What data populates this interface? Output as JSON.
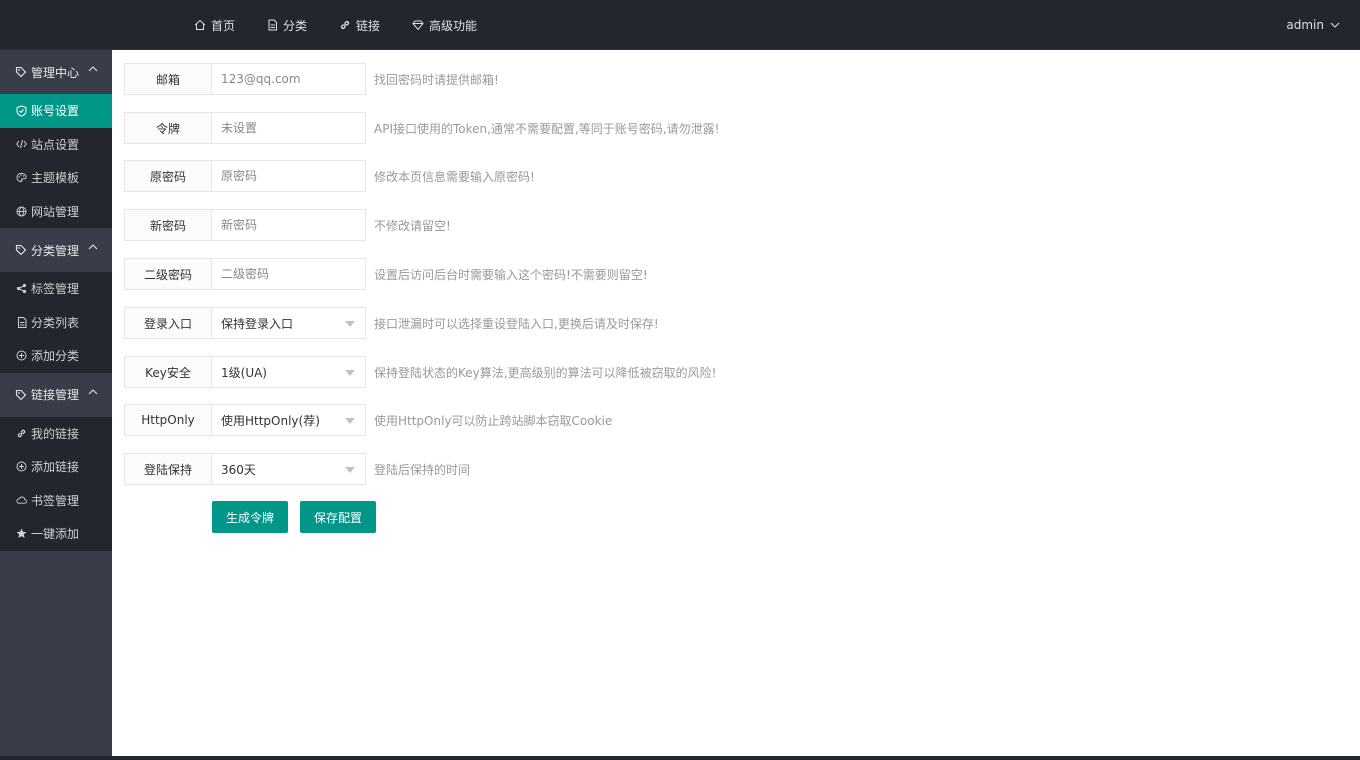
{
  "topnav": {
    "items": [
      {
        "label": "首页",
        "icon": "home-icon"
      },
      {
        "label": "分类",
        "icon": "file-icon"
      },
      {
        "label": "链接",
        "icon": "link-icon"
      },
      {
        "label": "高级功能",
        "icon": "diamond-icon"
      }
    ],
    "user": "admin"
  },
  "sidebar": {
    "groups": [
      {
        "title": "管理中心",
        "items": [
          {
            "label": "账号设置",
            "icon": "shield-icon",
            "active": true
          },
          {
            "label": "站点设置",
            "icon": "code-icon"
          },
          {
            "label": "主题模板",
            "icon": "palette-icon"
          },
          {
            "label": "网站管理",
            "icon": "globe-icon"
          }
        ]
      },
      {
        "title": "分类管理",
        "items": [
          {
            "label": "标签管理",
            "icon": "share-icon"
          },
          {
            "label": "分类列表",
            "icon": "file-icon"
          },
          {
            "label": "添加分类",
            "icon": "add-circle-icon"
          }
        ]
      },
      {
        "title": "链接管理",
        "items": [
          {
            "label": "我的链接",
            "icon": "link-icon"
          },
          {
            "label": "添加链接",
            "icon": "add-circle-icon"
          },
          {
            "label": "书签管理",
            "icon": "cloud-icon"
          },
          {
            "label": "一键添加",
            "icon": "star-icon"
          }
        ]
      }
    ]
  },
  "form": {
    "email": {
      "label": "邮箱",
      "value": "",
      "placeholder": "123@qq.com",
      "hint": "找回密码时请提供邮箱!"
    },
    "token": {
      "label": "令牌",
      "value": "",
      "placeholder": "未设置",
      "hint": "API接口使用的Token,通常不需要配置,等同于账号密码,请勿泄露!"
    },
    "old_password": {
      "label": "原密码",
      "value": "",
      "placeholder": "原密码",
      "hint": "修改本页信息需要输入原密码!"
    },
    "new_password": {
      "label": "新密码",
      "value": "",
      "placeholder": "新密码",
      "hint": "不修改请留空!"
    },
    "second_password": {
      "label": "二级密码",
      "value": "",
      "placeholder": "二级密码",
      "hint": "设置后访问后台时需要输入这个密码!不需要则留空!"
    },
    "login_entry": {
      "label": "登录入口",
      "selected": "保持登录入口",
      "hint": "接口泄漏时可以选择重设登陆入口,更换后请及时保存!"
    },
    "key_security": {
      "label": "Key安全",
      "selected": "1级(UA)",
      "hint": "保持登陆状态的Key算法,更高级别的算法可以降低被窃取的风险!"
    },
    "httponly": {
      "label": "HttpOnly",
      "selected": "使用HttpOnly(荐)",
      "hint": "使用HttpOnly可以防止跨站脚本窃取Cookie"
    },
    "login_keep": {
      "label": "登陆保持",
      "selected": "360天",
      "hint": "登陆后保持的时间"
    }
  },
  "buttons": {
    "generate_token": "生成令牌",
    "save_config": "保存配置"
  },
  "colors": {
    "accent": "#009688",
    "header_bg": "#23262e",
    "sidebar_bg": "#393d49"
  }
}
